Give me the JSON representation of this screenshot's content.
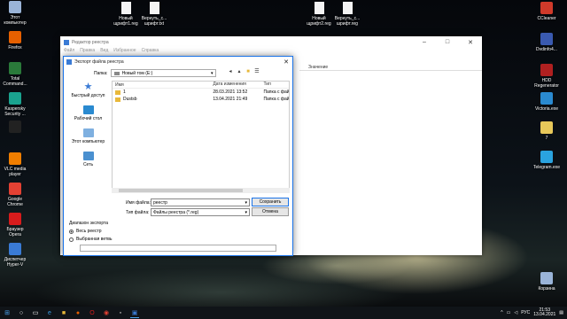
{
  "desktop": {
    "left_icons": [
      {
        "label": "Этот\nкомпьютер",
        "icon": "this-pc-icon",
        "color": "#9ab4d8"
      },
      {
        "label": "Firefox",
        "icon": "firefox-icon",
        "color": "#e66000"
      },
      {
        "label": "Total\nCommand...",
        "icon": "total-commander-icon",
        "color": "#2a7a3a"
      },
      {
        "label": "Kaspersky\nSecurity ...",
        "icon": "kaspersky-icon",
        "color": "#1aa38f"
      },
      {
        "label": "",
        "icon": "console-icon",
        "color": "#222222"
      },
      {
        "label": "VLC media\nplayer",
        "icon": "vlc-icon",
        "color": "#f07e00"
      },
      {
        "label": "Google\nChrome",
        "icon": "chrome-icon",
        "color": "#e34133"
      },
      {
        "label": "Браузер\nOpera",
        "icon": "opera-icon",
        "color": "#d81c1c"
      },
      {
        "label": "Диспетчер\nHyper-V",
        "icon": "hyperv-icon",
        "color": "#3a7bd5"
      }
    ],
    "top_icons": [
      {
        "label": "Новый\nщрифт1.reg",
        "icon": "reg-file-icon"
      },
      {
        "label": "Вернуть_с...\nшрифт.txt",
        "icon": "txt-file-icon"
      },
      {
        "label": "Новый\nщрифт2.reg",
        "icon": "reg-file-icon"
      },
      {
        "label": "Вернуть_с...\nшрифт.reg",
        "icon": "reg-file-icon"
      }
    ],
    "right_icons": [
      {
        "label": "CCleaner",
        "icon": "ccleaner-icon",
        "color": "#d03a2a"
      },
      {
        "label": "Dvdinfo4...",
        "icon": "dvdinfo-icon",
        "color": "#3a5ab0"
      },
      {
        "label": "HDD\nRegenerator",
        "icon": "hdd-regenerator-icon",
        "color": "#b02020"
      },
      {
        "label": "Victoria.exe",
        "icon": "victoria-icon",
        "color": "#2a8ad0"
      },
      {
        "label": "7",
        "icon": "file-icon",
        "color": "#e8c85a"
      },
      {
        "label": "Telegram.exe",
        "icon": "telegram-icon",
        "color": "#2aa3e0"
      },
      {
        "label": "Корзина",
        "icon": "recycle-bin-icon",
        "color": "#9ab4d8"
      }
    ]
  },
  "regedit": {
    "title": "Редактор реестра",
    "menu": [
      "Файл",
      "Правка",
      "Вид",
      "Избранное",
      "Справка"
    ],
    "column_value": "Значение"
  },
  "dialog": {
    "title": "Экспорт файла реестра",
    "folder_label": "Папка:",
    "folder_value": "Новый том (E:)",
    "places": [
      {
        "label": "Быстрый доступ",
        "icon": "star-icon"
      },
      {
        "label": "Рабочий стол",
        "icon": "desktop-icon"
      },
      {
        "label": "Этот компьютер",
        "icon": "computer-icon"
      },
      {
        "label": "Сеть",
        "icon": "network-icon"
      }
    ],
    "columns": {
      "name": "Имя",
      "date": "Дата изменения",
      "type": "Тип"
    },
    "files": [
      {
        "name": "1",
        "date": "28.03.2021 13:52",
        "type": "Папка с фай"
      },
      {
        "name": "Dustsb",
        "date": "13.04.2021 21:49",
        "type": "Папка с фай"
      }
    ],
    "filename_label": "Имя файла:",
    "filename_value": "реестр",
    "filetype_label": "Тип файла:",
    "filetype_value": "Файлы реестра (*.reg)",
    "save_label": "Сохранить",
    "cancel_label": "Отмена",
    "range_title": "Диапазон экспорта",
    "range_all": "Весь реестр",
    "range_branch": "Выбранная ветвь"
  },
  "taskbar": {
    "lang": "РУС",
    "time": "21:53",
    "date": "13.04.2021"
  }
}
